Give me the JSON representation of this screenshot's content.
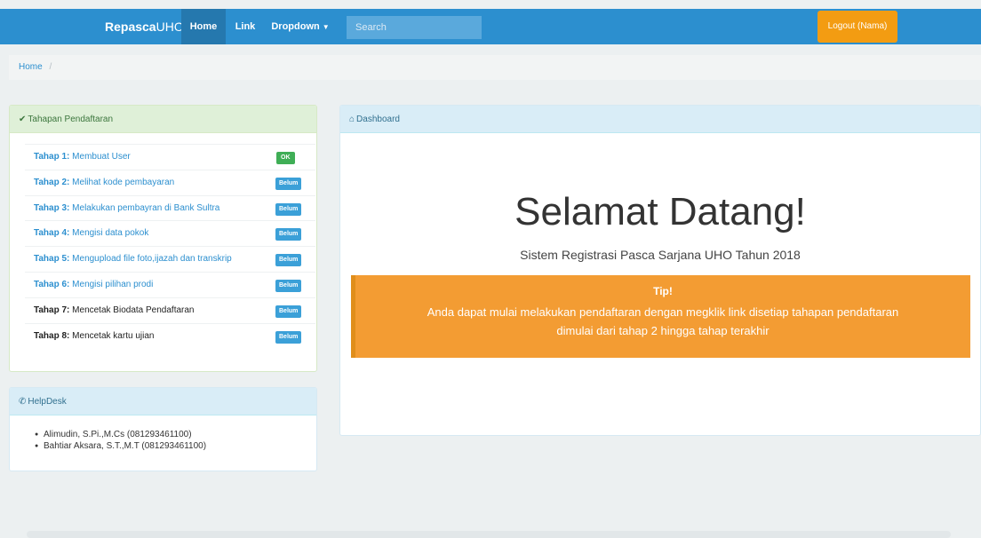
{
  "navbar": {
    "brand_bold": "Repasca",
    "brand_rest": "UHO",
    "home": "Home",
    "link": "Link",
    "dropdown": "Dropdown",
    "search_placeholder": "Search",
    "logout": "Logout (Nama)"
  },
  "breadcrumb": {
    "home": "Home",
    "separator": "/"
  },
  "tahapan": {
    "title": "Tahapan Pendaftaran",
    "steps": [
      {
        "prefix": "Tahap 1:",
        "text": "Membuat User",
        "status": "OK"
      },
      {
        "prefix": "Tahap 2:",
        "text": "Melihat kode pembayaran",
        "status": "Belum"
      },
      {
        "prefix": "Tahap 3:",
        "text": "Melakukan pembayran di Bank Sultra",
        "status": "Belum"
      },
      {
        "prefix": "Tahap 4:",
        "text": "Mengisi data pokok",
        "status": "Belum"
      },
      {
        "prefix": "Tahap 5:",
        "text": "Mengupload file foto,ijazah dan transkrip",
        "status": "Belum"
      },
      {
        "prefix": "Tahap 6:",
        "text": "Mengisi pilihan prodi",
        "status": "Belum"
      },
      {
        "prefix": "Tahap 7:",
        "text": "Mencetak Biodata Pendaftaran",
        "status": "Belum"
      },
      {
        "prefix": "Tahap 8:",
        "text": "Mencetak kartu ujian",
        "status": "Belum"
      }
    ]
  },
  "helpdesk": {
    "title": "HelpDesk",
    "contacts": [
      "Alimudin, S.Pi.,M.Cs (081293461100)",
      "Bahtiar Aksara, S.T.,M.T (081293461100)"
    ]
  },
  "dashboard": {
    "title": "Dashboard",
    "heading": "Selamat Datang!",
    "subtitle": "Sistem Registrasi Pasca Sarjana UHO Tahun 2018",
    "tip_title": "Tip!",
    "tip_line1": "Anda dapat mulai melakukan pendaftaran dengan megklik link disetiap tahapan pendaftaran",
    "tip_line2": "dimulai dari tahap 2 hingga tahap terakhir"
  },
  "colors": {
    "navbar": "#2c8fcf",
    "logout": "#f39c12",
    "tip": "#f39c33",
    "ok_badge": "#3fae56",
    "belum_badge": "#3ba0d8"
  },
  "icons": [
    "check-icon",
    "home-icon",
    "phone-icon",
    "caret-down-icon"
  ]
}
